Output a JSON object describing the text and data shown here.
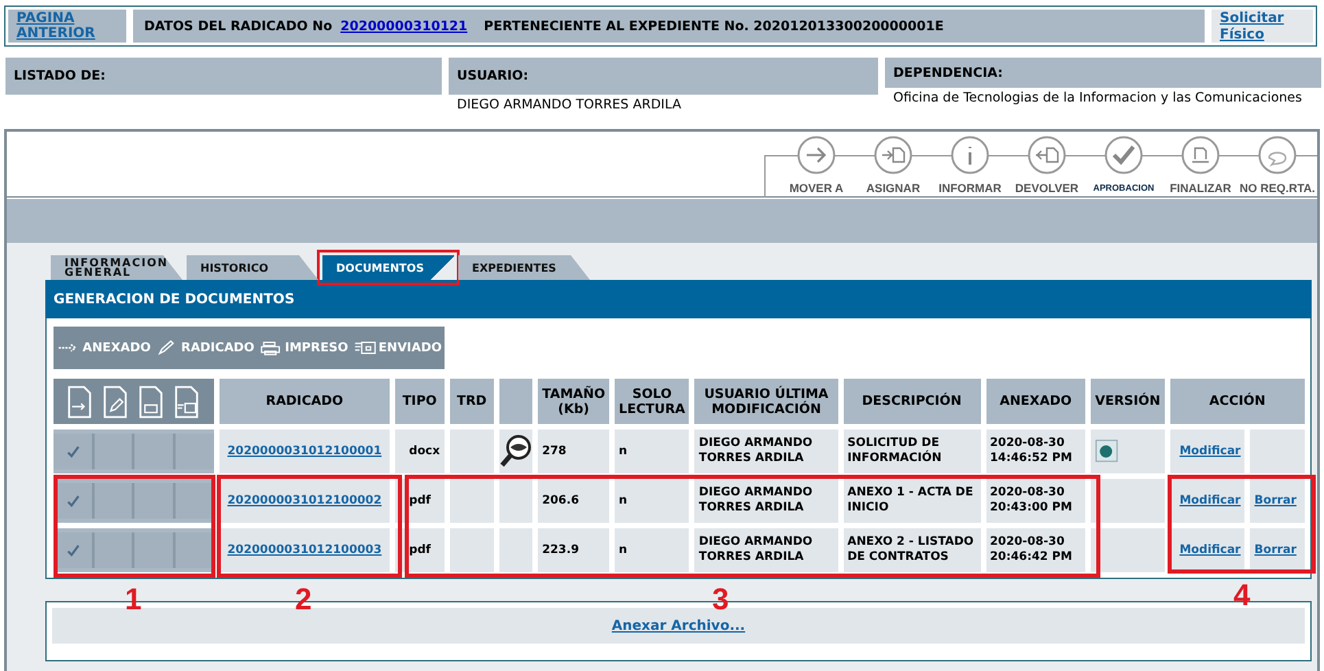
{
  "header": {
    "back_link": "PAGINA ANTERIOR",
    "title_prefix": "DATOS DEL RADICADO No",
    "radicado_link": "20200000310121",
    "expediente_text": "PERTENECIENTE AL EXPEDIENTE No. 20201201330020000001E",
    "request_link": "Solicitar Físico"
  },
  "info": [
    {
      "label": "LISTADO DE:"
    },
    {
      "label": "USUARIO:",
      "value": "DIEGO ARMANDO TORRES ARDILA"
    },
    {
      "label": "DEPENDENCIA:",
      "value": "Oficina de Tecnologias de la Informacion y las Comunicaciones"
    }
  ],
  "actions": [
    {
      "label": "MOVER A"
    },
    {
      "label": "ASIGNAR"
    },
    {
      "label": "INFORMAR"
    },
    {
      "label": "DEVOLVER"
    },
    {
      "label": "APROBACION"
    },
    {
      "label": "FINALIZAR"
    },
    {
      "label": "NO REQ.RTA."
    }
  ],
  "tabs": [
    {
      "label": "INFORMACION GENERAL",
      "selected": false,
      "highlighted": false
    },
    {
      "label": "HISTORICO",
      "selected": false,
      "highlighted": false
    },
    {
      "label": "DOCUMENTOS",
      "selected": true,
      "highlighted": true
    },
    {
      "label": "EXPEDIENTES",
      "selected": false,
      "highlighted": false
    }
  ],
  "section_title": "GENERACION DE DOCUMENTOS",
  "legend": [
    "ANEXADO",
    "RADICADO",
    "IMPRESO",
    "ENVIADO"
  ],
  "table": {
    "columns": [
      "RADICADO",
      "TIPO",
      "TRD",
      "TAMAÑO (Kb)",
      "SOLO LECTURA",
      "USUARIO ÚLTIMA MODIFICACIÓN",
      "DESCRIPCIÓN",
      "ANEXADO",
      "VERSIÓN",
      "ACCIÓN"
    ],
    "rows": [
      {
        "status": [
          true,
          false,
          false,
          false
        ],
        "radicado": "2020000031012100001",
        "tipo": "docx",
        "preview": true,
        "size": "278",
        "read_only": "n",
        "user": "DIEGO ARMANDO TORRES ARDILA",
        "description": "SOLICITUD DE INFORMACIÓN",
        "date": "2020-08-30 14:46:52 PM",
        "version_icon": true,
        "actions": [
          "Modificar"
        ]
      },
      {
        "status": [
          true,
          false,
          false,
          false
        ],
        "radicado": "2020000031012100002",
        "tipo": "pdf",
        "preview": false,
        "size": "206.6",
        "read_only": "n",
        "user": "DIEGO ARMANDO TORRES ARDILA",
        "description": "ANEXO 1 - ACTA DE INICIO",
        "date": "2020-08-30 20:43:00 PM",
        "version_icon": false,
        "actions": [
          "Modificar",
          "Borrar"
        ]
      },
      {
        "status": [
          true,
          false,
          false,
          false
        ],
        "radicado": "2020000031012100003",
        "tipo": "pdf",
        "preview": false,
        "size": "223.9",
        "read_only": "n",
        "user": "DIEGO ARMANDO TORRES ARDILA",
        "description": "ANEXO 2 - LISTADO DE CONTRATOS",
        "date": "2020-08-30 20:46:42 PM",
        "version_icon": false,
        "actions": [
          "Modificar",
          "Borrar"
        ]
      }
    ]
  },
  "attach_link": "Anexar Archivo...",
  "annotations": [
    {
      "label": "1"
    },
    {
      "label": "2"
    },
    {
      "label": "3"
    },
    {
      "label": "4"
    }
  ]
}
